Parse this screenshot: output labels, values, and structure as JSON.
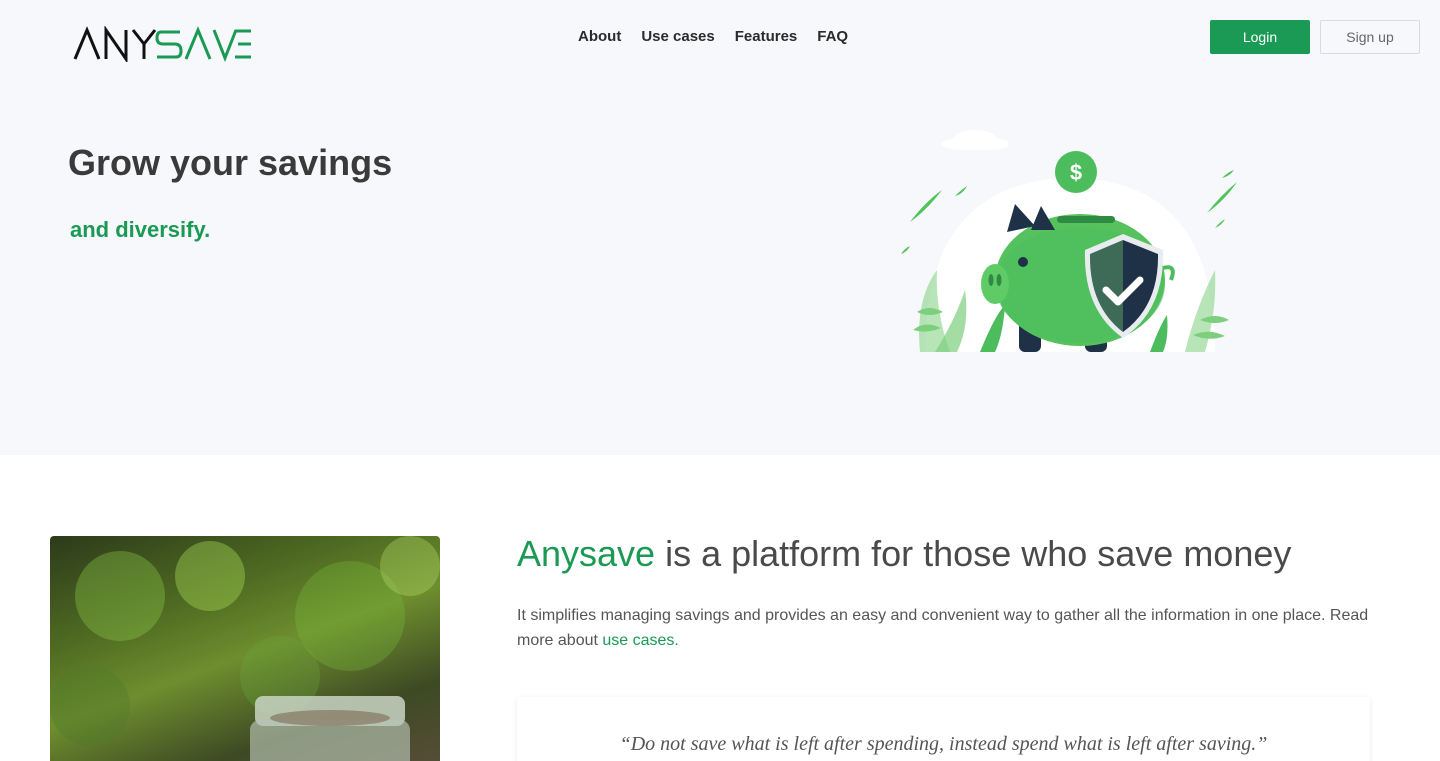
{
  "brand": {
    "logo_part1": "ANY",
    "logo_part2": "SAVE",
    "logo_icon": "anysave-logo",
    "colors": {
      "accent": "#1a9a54",
      "text": "#3a3a3a",
      "hero_bg": "#f7f8fb"
    }
  },
  "nav": {
    "items": [
      {
        "label": "About"
      },
      {
        "label": "Use cases"
      },
      {
        "label": "Features"
      },
      {
        "label": "FAQ"
      }
    ]
  },
  "auth": {
    "login_label": "Login",
    "signup_label": "Sign up"
  },
  "hero": {
    "title": "Grow your savings",
    "subtitle": "and diversify.",
    "illustration_icon": "piggy-bank-shield-illustration"
  },
  "about": {
    "title_brand": "Anysave",
    "title_rest": " is a platform for those who save money",
    "text_before_link": "It simplifies managing savings and provides an easy and convenient way to gather all the information in one place. Read more about ",
    "link_label": "use cases.",
    "photo_icon": "coin-jar-photo"
  },
  "quote": {
    "text": "“Do not save what is left after spending, instead spend what is left after saving.”"
  }
}
